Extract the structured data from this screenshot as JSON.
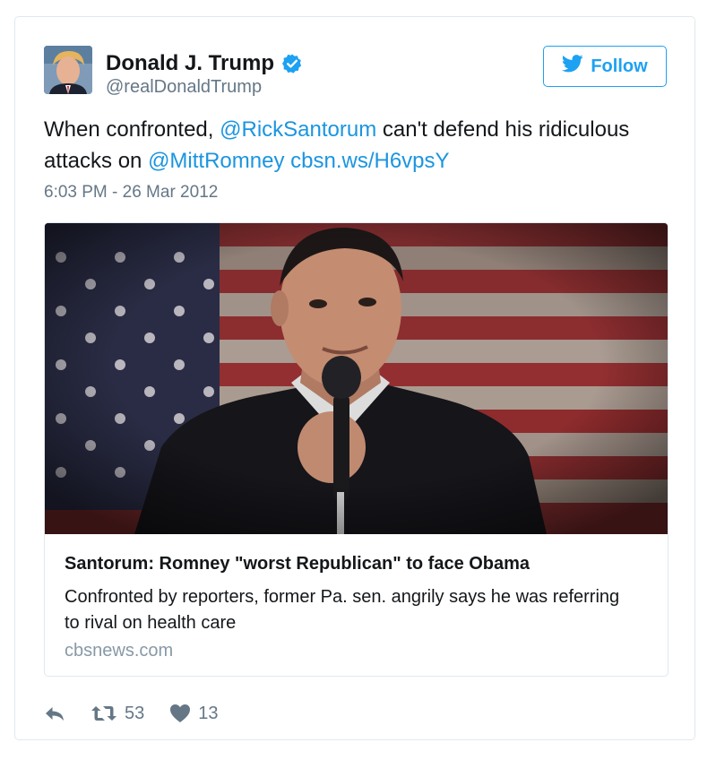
{
  "author": {
    "name": "Donald J. Trump",
    "handle": "@realDonaldTrump",
    "avatar_icon": "profile-photo"
  },
  "follow_button": {
    "label": "Follow",
    "icon": "twitter-bird-icon"
  },
  "tweet": {
    "text_1": "When confronted, ",
    "mention_1": "@RickSantorum",
    "text_2": " can't defend his ridiculous attacks on ",
    "mention_2": "@MittRomney",
    "text_3": " ",
    "link": "cbsn.ws/H6vpsY",
    "timestamp": "6:03 PM - 26 Mar 2012"
  },
  "link_card": {
    "title": "Santorum: Romney \"worst Republican\" to face Obama",
    "description": "Confronted by reporters, former Pa. sen. angrily says he was referring to rival on health care",
    "domain": "cbsnews.com"
  },
  "actions": {
    "reply_icon": "reply-icon",
    "retweet_icon": "retweet-icon",
    "retweet_count": "53",
    "like_icon": "heart-icon",
    "like_count": "13"
  },
  "colors": {
    "accent": "#1da1f2",
    "link": "#1b95e0",
    "muted": "#657786",
    "border": "#e1e8ed"
  }
}
